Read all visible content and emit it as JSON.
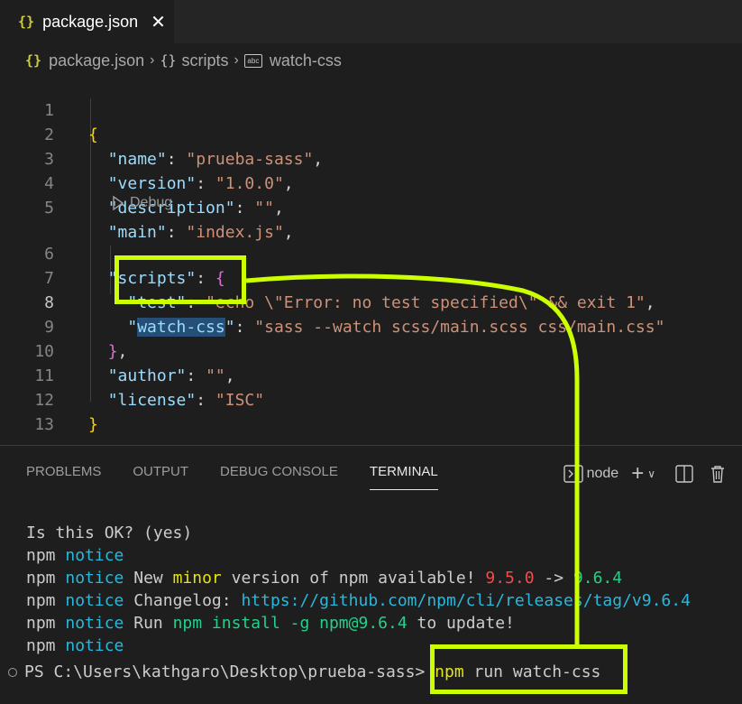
{
  "tab": {
    "icon": "{}",
    "label": "package.json",
    "close": "✕"
  },
  "breadcrumb": {
    "file": "package.json",
    "section": "scripts",
    "item": "watch-css"
  },
  "editor": {
    "codelens": "Debug",
    "line_numbers": [
      "1",
      "2",
      "3",
      "4",
      "5",
      "6",
      "7",
      "8",
      "9",
      "10",
      "11",
      "12",
      "13"
    ],
    "lines": {
      "l1_open": "{",
      "l2_key": "\"name\"",
      "l2_val": "\"prueba-sass\"",
      "l3_key": "\"version\"",
      "l3_val": "\"1.0.0\"",
      "l4_key": "\"description\"",
      "l4_val": "\"\"",
      "l5_key": "\"main\"",
      "l5_val": "\"index.js\"",
      "l6_key": "\"scripts\"",
      "l6_open": "{",
      "l7_key": "\"test\"",
      "l7_val": "\"echo \\\"Error: no test specified\\\" && exit 1\"",
      "l8_key_q1": "\"",
      "l8_key_sel": "watch-css",
      "l8_key_q2": "\"",
      "l8_val": "\"sass --watch scss/main.scss css/main.css\"",
      "l9_close": "}",
      "l10_key": "\"author\"",
      "l10_val": "\"\"",
      "l11_key": "\"license\"",
      "l11_val": "\"ISC\"",
      "l12_close": "}"
    }
  },
  "panel": {
    "tabs": [
      "PROBLEMS",
      "OUTPUT",
      "DEBUG CONSOLE",
      "TERMINAL"
    ],
    "active_tab": "TERMINAL",
    "terminal_name": "node",
    "terminal": {
      "l1": "Is this OK? (yes)",
      "npm": "npm",
      "notice": "notice",
      "l3_a": " New ",
      "l3_minor": "minor",
      "l3_b": " version of npm available! ",
      "l3_old": "9.5.0",
      "l3_arrow": " -> ",
      "l3_new": "9.6.4",
      "l4_a": " Changelog: ",
      "l4_url": "https://github.com/npm/cli/releases/tag/v9.6.4",
      "l5_a": " Run ",
      "l5_cmd": "npm install -g npm@9.6.4",
      "l5_b": " to update!",
      "prompt": "PS C:\\Users\\kathgaro\\Desktop\\prueba-sass> ",
      "cmd_npm": "npm",
      "cmd_rest": " run watch-css"
    }
  },
  "colors": {
    "highlight": "#ccff00",
    "editor_bg": "#1e1e1e",
    "key": "#9cdcfe",
    "string": "#ce9178"
  }
}
